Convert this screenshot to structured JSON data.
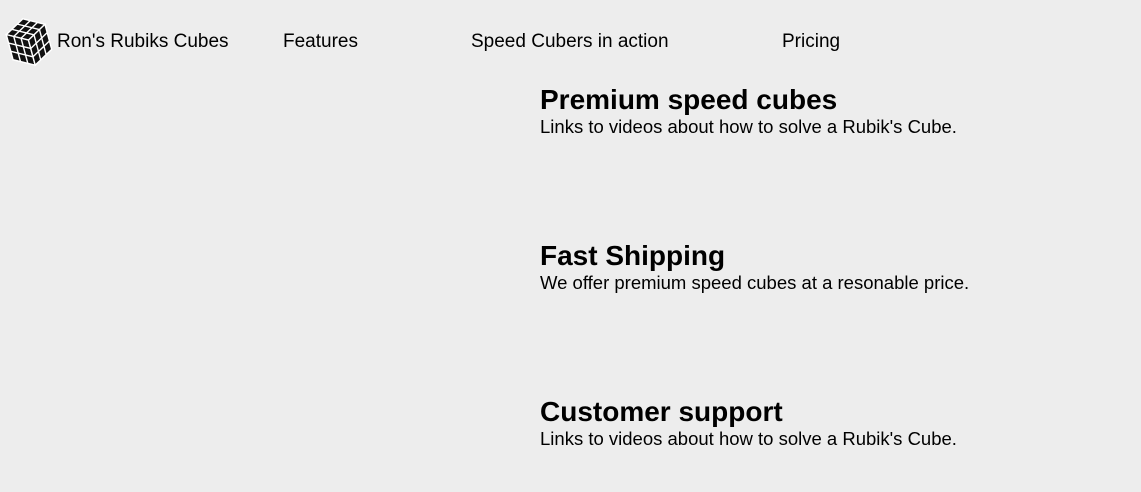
{
  "header": {
    "brand": "Ron's Rubiks Cubes",
    "logo_icon": "rubiks-cube-icon",
    "nav": [
      {
        "label": "Features"
      },
      {
        "label": "Speed Cubers in action"
      },
      {
        "label": "Pricing"
      }
    ]
  },
  "features": [
    {
      "title": "Premium speed cubes",
      "description": "Links to videos about how to solve a Rubik's Cube."
    },
    {
      "title": "Fast Shipping",
      "description": "We offer premium speed cubes at a resonable price."
    },
    {
      "title": "Customer support",
      "description": "Links to videos about how to solve a Rubik's Cube."
    }
  ],
  "colors": {
    "background": "#ededed",
    "text": "#000000"
  }
}
